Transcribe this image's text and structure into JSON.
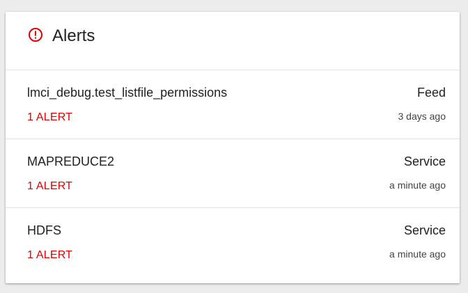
{
  "colors": {
    "accent_red": "#e00000",
    "text_primary": "#212121",
    "divider": "#e0e0e0",
    "background": "#ececec",
    "card": "#ffffff"
  },
  "header": {
    "icon": "alert-circle-icon",
    "title": "Alerts"
  },
  "alerts": [
    {
      "name": "lmci_debug.test_listfile_permissions",
      "count_label": "1 ALERT",
      "type": "Feed",
      "time": "3 days ago"
    },
    {
      "name": "MAPREDUCE2",
      "count_label": "1 ALERT",
      "type": "Service",
      "time": "a minute ago"
    },
    {
      "name": "HDFS",
      "count_label": "1 ALERT",
      "type": "Service",
      "time": "a minute ago"
    }
  ]
}
